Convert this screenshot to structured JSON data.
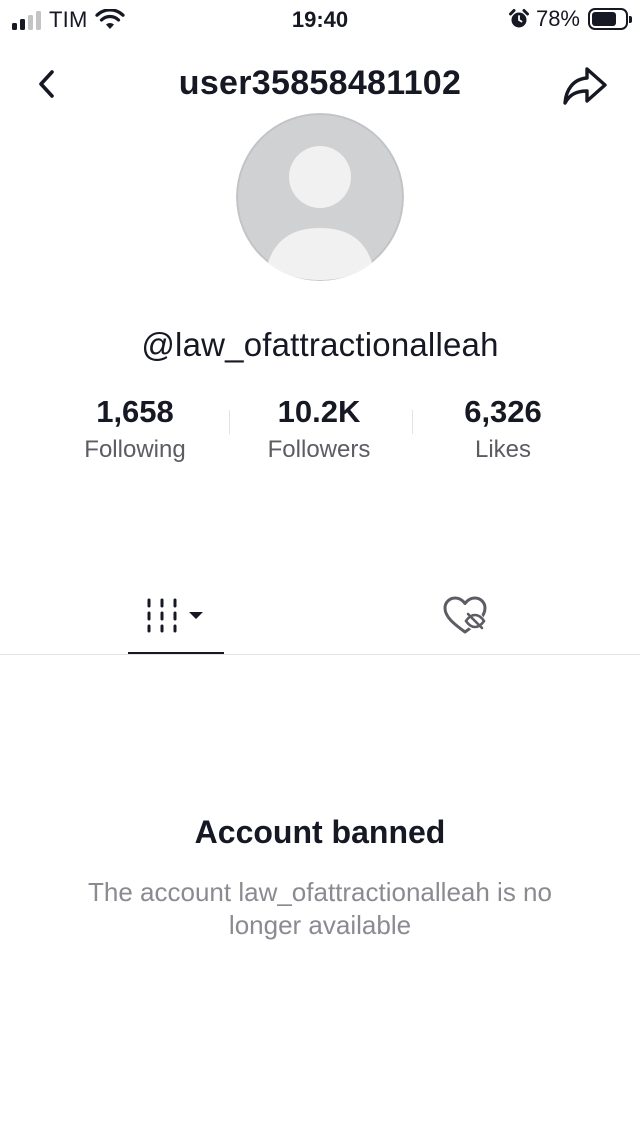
{
  "status_bar": {
    "carrier": "TIM",
    "time": "19:40",
    "battery_percent": "78%",
    "battery_level": 0.78,
    "signal_bars_active": 2,
    "signal_bars_total": 4,
    "icons": [
      "signal-icon",
      "wifi-icon",
      "alarm-icon",
      "battery-icon"
    ]
  },
  "header": {
    "title": "user35858481102",
    "back_icon": "chevron-left-icon",
    "share_icon": "share-arrow-icon"
  },
  "profile": {
    "handle": "@law_ofattractionalleah",
    "avatar": "default-avatar",
    "stats": [
      {
        "value": "1,658",
        "label": "Following"
      },
      {
        "value": "10.2K",
        "label": "Followers"
      },
      {
        "value": "6,326",
        "label": "Likes"
      }
    ]
  },
  "tabs": {
    "active": "videos",
    "items": [
      {
        "id": "videos",
        "icon": "videos-grid-icon"
      },
      {
        "id": "liked",
        "icon": "liked-hidden-icon"
      }
    ]
  },
  "empty_state": {
    "title": "Account banned",
    "description": "The account law_ofattractionalleah is no longer available"
  },
  "colors": {
    "text_primary": "#161823",
    "text_secondary": "#5c5c63",
    "text_muted": "#8a8b91",
    "avatar_bg": "#d0d1d3",
    "avatar_fg": "#f1f1f2",
    "divider": "#e3e3e6"
  }
}
